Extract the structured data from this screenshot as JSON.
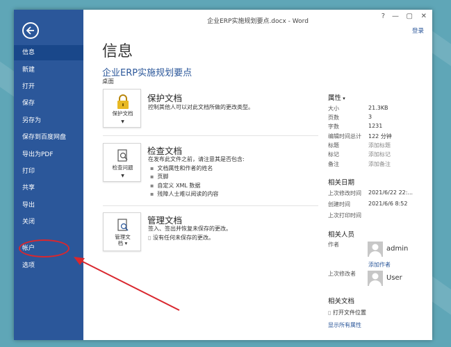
{
  "window_title": "企业ERP实施规划要点.docx - Word",
  "titlebar": {
    "help": "?",
    "minimize": "—",
    "maximize": "▢",
    "close": "✕",
    "signin": "登录"
  },
  "sidebar": {
    "items": [
      {
        "label": "信息"
      },
      {
        "label": "新建"
      },
      {
        "label": "打开"
      },
      {
        "label": "保存"
      },
      {
        "label": "另存为"
      },
      {
        "label": "保存到百度网盘"
      },
      {
        "label": "导出为PDF"
      },
      {
        "label": "打印"
      },
      {
        "label": "共享"
      },
      {
        "label": "导出"
      },
      {
        "label": "关闭"
      },
      {
        "label": "帐户"
      },
      {
        "label": "选项"
      }
    ]
  },
  "main": {
    "heading": "信息",
    "doc_name": "企业ERP实施规划要点",
    "doc_path": "桌面",
    "protect": {
      "button_label": "保护文档",
      "title": "保护文档",
      "desc": "控制其他人可以对此文档所做的更改类型。"
    },
    "inspect": {
      "button_label": "检查问题",
      "title": "检查文档",
      "desc": "在发布此文件之前，请注意其是否包含:",
      "bullets": [
        "文档属性和作者的姓名",
        "页脚",
        "自定义 XML 数据",
        "残障人士难以阅读的内容"
      ]
    },
    "manage": {
      "button_label_1": "管理文",
      "button_label_2": "档",
      "title": "管理文档",
      "desc": "签入、签出并恢复未保存的更改。",
      "sub": "没有任何未保存的更改。"
    }
  },
  "properties": {
    "heading": "属性",
    "rows": [
      {
        "label": "大小",
        "value": "21.3KB"
      },
      {
        "label": "页数",
        "value": "3"
      },
      {
        "label": "字数",
        "value": "1231"
      },
      {
        "label": "编辑时间总计",
        "value": "122 分钟"
      },
      {
        "label": "标题",
        "value": "添加标题"
      },
      {
        "label": "标记",
        "value": "添加标记"
      },
      {
        "label": "备注",
        "value": "添加备注"
      }
    ],
    "dates": {
      "heading": "相关日期",
      "rows": [
        {
          "label": "上次修改时间",
          "value": "2021/6/22 22:..."
        },
        {
          "label": "创建时间",
          "value": "2021/6/6 8:52"
        },
        {
          "label": "上次打印时间",
          "value": ""
        }
      ]
    },
    "people": {
      "heading": "相关人员",
      "author_label": "作者",
      "author_name": "admin",
      "add_author": "添加作者",
      "modifier_label": "上次修改者",
      "modifier_name": "User"
    },
    "docs": {
      "heading": "相关文档",
      "open_location": "打开文件位置",
      "show_all": "显示所有属性"
    }
  },
  "colors": {
    "sidebar": "#2b579a",
    "annotation": "#d9272e",
    "background": "#5fa6b7"
  }
}
